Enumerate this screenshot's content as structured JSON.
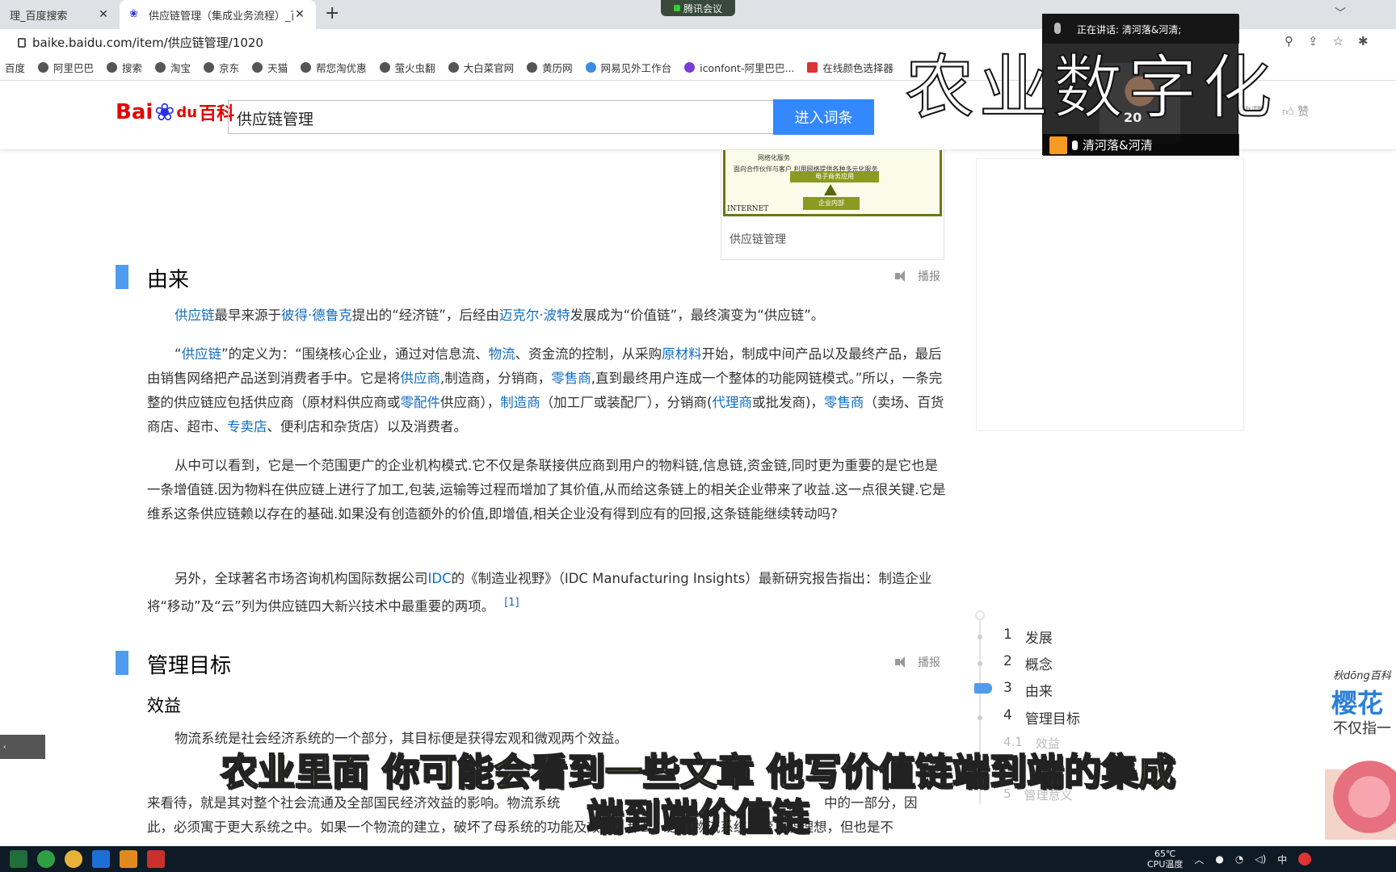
{
  "browser": {
    "tabs": [
      {
        "title": "理_百度搜索",
        "active": false
      },
      {
        "title": "供应链管理（集成业务流程）_百",
        "active": true
      }
    ],
    "meeting_pill": "腾讯会议",
    "url": "baike.baidu.com/item/供应链管理/1020",
    "bookmarks": [
      "百度",
      "阿里巴巴",
      "搜索",
      "淘宝",
      "京东",
      "天猫",
      "帮您淘优惠",
      "萤火虫翻",
      "大白菜官网",
      "黄历网",
      "网易见外工作台",
      "iconfont-阿里巴巴...",
      "在线颜色选择器"
    ]
  },
  "header": {
    "logo_text": "Bai",
    "logo_du": "du",
    "logo_baike": "百科",
    "search_value": "供应链管理",
    "search_button": "进入词条",
    "collect": "收藏",
    "like": "赞"
  },
  "image_card": {
    "caption": "供应链管理",
    "note1": "网络化服务",
    "note2": "面向合作伙伴与客户    利用网络提供各种多元化服务",
    "bar1": "电子商务应用",
    "bar2": "企业内部",
    "internet": "INTERNET"
  },
  "sections": {
    "origin": {
      "title": "由来",
      "report": "播报",
      "p1": [
        "供应链",
        "最早来源于",
        "彼得·德鲁克",
        "提出的“经济链”，后经由",
        "迈克尔·波特",
        "发展成为“价值链”，最终演变为“供应链”。"
      ],
      "p2": [
        "“",
        "供应链",
        "”的定义为：“围绕核心企业，通过对信息流、",
        "物流",
        "、资金流的控制，从采购",
        "原材料",
        "开始，制成中间产品以及最终产品，最后由销售网络把产品送到消费者手中。它是将",
        "供应商",
        ",制造商，分销商，",
        "零售商",
        ",直到最终用户连成一个整体的功能网链模式。”所以，一条完整的供应链应包括供应商（原材料供应商或",
        "零配件",
        "供应商），",
        "制造商",
        "（加工厂或装配厂），分销商(",
        "代理商",
        "或批发商)，",
        "零售商",
        "（卖场、百货商店、超市、",
        "专卖店",
        "、便利店和杂货店）以及消费者。"
      ],
      "p3": "从中可以看到，它是一个范围更广的企业机构模式.它不仅是条联接供应商到用户的物料链,信息链,资金链,同时更为重要的是它也是一条增值链.因为物料在供应链上进行了加工,包装,运输等过程而增加了其价值,从而给这条链上的相关企业带来了收益.这一点很关键.它是维系这条供应链赖以存在的基础.如果没有创造额外的价值,即增值,相关企业没有得到应有的回报,这条链能继续转动吗?",
      "p4": [
        "另外，全球著名市场咨询机构国际数据公司",
        "IDC",
        "的《制造业视野》（IDC Manufacturing Insights）最新研究报告指出：制造企业将“移动”及“云”列为供应链四大新兴技术中最重要的两项。"
      ],
      "ref": "[1]"
    },
    "goals": {
      "title": "管理目标",
      "report": "播报",
      "sub": "效益",
      "p1": "物流系统是社会经济系统的一个部分，其目标便是获得宏观和微观两个效益。",
      "p2_visible": "来看待，就是其对整个社会流通及全部国民经济效益的影响。物流系统",
      "p2b_visible": "中的一部分，因",
      "p3_visible": "此，必须寓于更大系统之中。如果一个物流的建立，破坏了母系统的功能及效益，那么，这一物流系统尽管功能理想，但也是不"
    }
  },
  "toc": [
    {
      "num": "1",
      "label": "发展",
      "active": false
    },
    {
      "num": "2",
      "label": "概念",
      "active": false
    },
    {
      "num": "3",
      "label": "由来",
      "active": true
    },
    {
      "num": "4",
      "label": "管理目标",
      "active": false
    },
    {
      "num": "4.1",
      "label": "效益",
      "active": false
    },
    {
      "num": "5",
      "label": "管理意义",
      "active": false
    }
  ],
  "video": {
    "speaking": "正在讲话: 清河落&河清;",
    "name": "清河落&河清",
    "jersey": "20"
  },
  "overlay_title": "农业数字化",
  "subtitles": [
    "农业里面 你可能会看到一些文章 他写价值链端到端的集成",
    "端到端价值链"
  ],
  "ad": {
    "brand": "秋dōng百科",
    "big": "樱花",
    "small": "不仅指一"
  },
  "taskbar": {
    "temp": "65℃",
    "cpu_label": "CPU温度",
    "ime": "中"
  }
}
